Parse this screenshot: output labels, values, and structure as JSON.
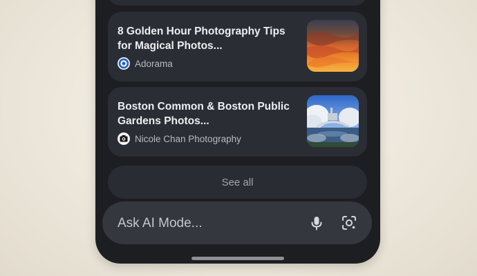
{
  "results": [
    {
      "title": "8 Golden Hour Photography Tips for Magical Photos...",
      "source": "Adorama",
      "source_icon": "adorama-logo-icon",
      "thumbnail": "sunset-sky-thumbnail"
    },
    {
      "title": "Boston Common & Boston Public Gardens Photos...",
      "source": "Nicole Chan Photography",
      "source_icon": "camera-logo-icon",
      "thumbnail": "park-bridge-thumbnail"
    }
  ],
  "see_all_label": "See all",
  "search": {
    "placeholder": "Ask AI Mode...",
    "mic_icon": "microphone-icon",
    "lens_icon": "camera-lens-icon"
  },
  "colors": {
    "phone_bg": "#1d1e22",
    "card_bg": "#2b2d34",
    "input_bg": "#35373e",
    "title_text": "#eceef2",
    "source_text": "#b7bac2"
  }
}
